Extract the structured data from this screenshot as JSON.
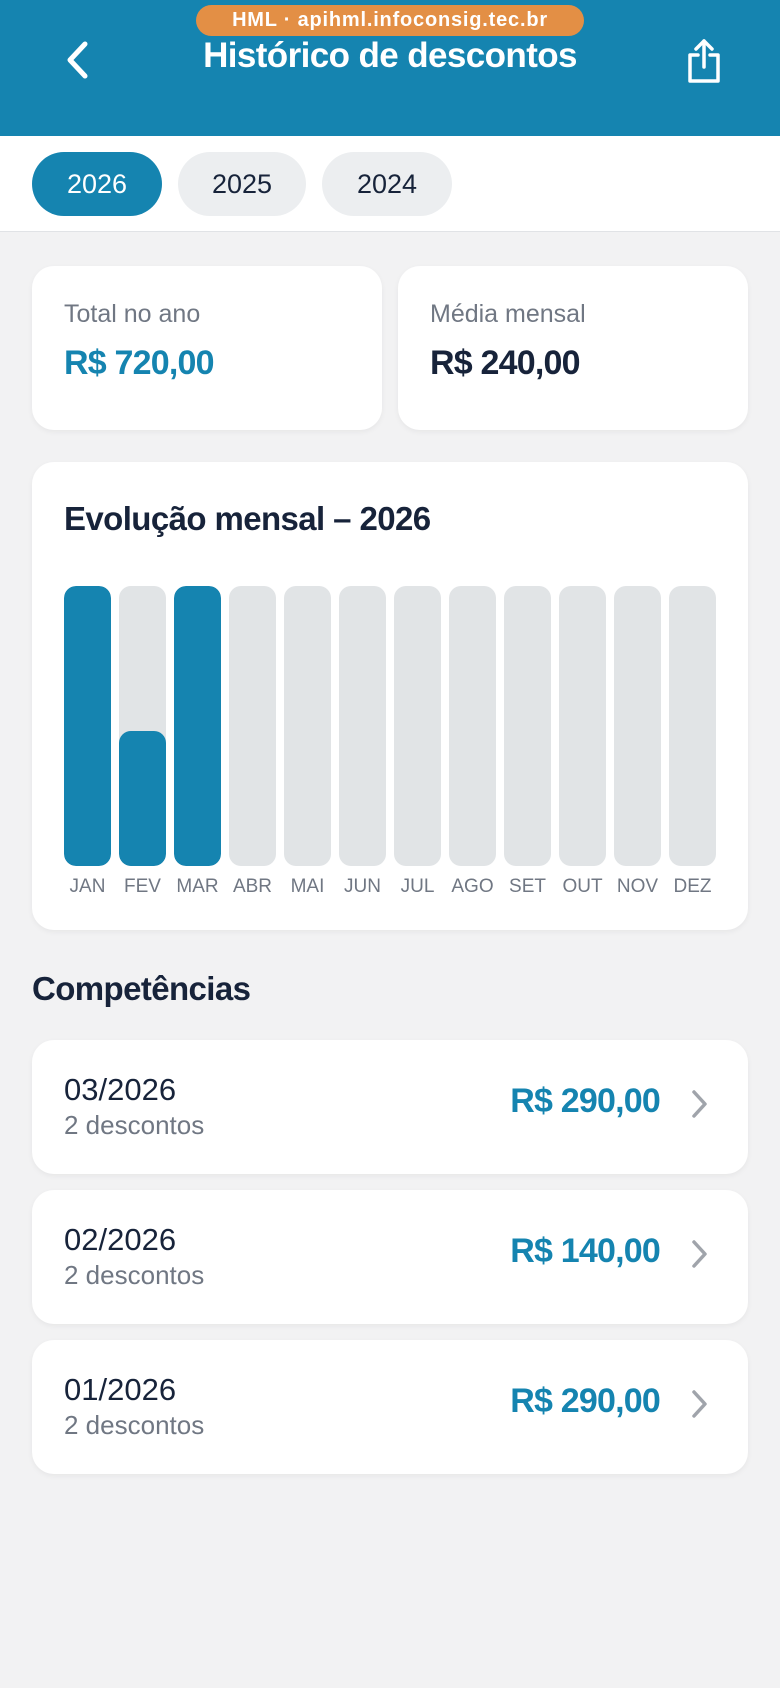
{
  "header": {
    "env_badge": "HML · apihml.infoconsig.tec.br",
    "title": "Histórico de descontos",
    "back_icon": "chevron-left-icon",
    "share_icon": "share-icon"
  },
  "year_tabs": [
    {
      "label": "2026",
      "active": true
    },
    {
      "label": "2025",
      "active": false
    },
    {
      "label": "2024",
      "active": false
    }
  ],
  "summary": {
    "total": {
      "label": "Total no ano",
      "value": "R$ 720,00"
    },
    "average": {
      "label": "Média mensal",
      "value": "R$ 240,00"
    }
  },
  "chart_data": {
    "type": "bar",
    "title": "Evolução mensal – 2026",
    "categories": [
      "JAN",
      "FEV",
      "MAR",
      "ABR",
      "MAI",
      "JUN",
      "JUL",
      "AGO",
      "SET",
      "OUT",
      "NOV",
      "DEZ"
    ],
    "values": [
      290,
      140,
      290,
      0,
      0,
      0,
      0,
      0,
      0,
      0,
      0,
      0
    ],
    "ylim": [
      0,
      290
    ],
    "xlabel": "",
    "ylabel": ""
  },
  "competencias": {
    "title": "Competências",
    "items": [
      {
        "period": "03/2026",
        "count": "2 descontos",
        "amount": "R$ 290,00"
      },
      {
        "period": "02/2026",
        "count": "2 descontos",
        "amount": "R$ 140,00"
      },
      {
        "period": "01/2026",
        "count": "2 descontos",
        "amount": "R$ 290,00"
      }
    ]
  },
  "colors": {
    "primary": "#1584b0",
    "badge": "#e38f45",
    "bar_track": "#e1e4e6",
    "background": "#f2f2f3"
  }
}
